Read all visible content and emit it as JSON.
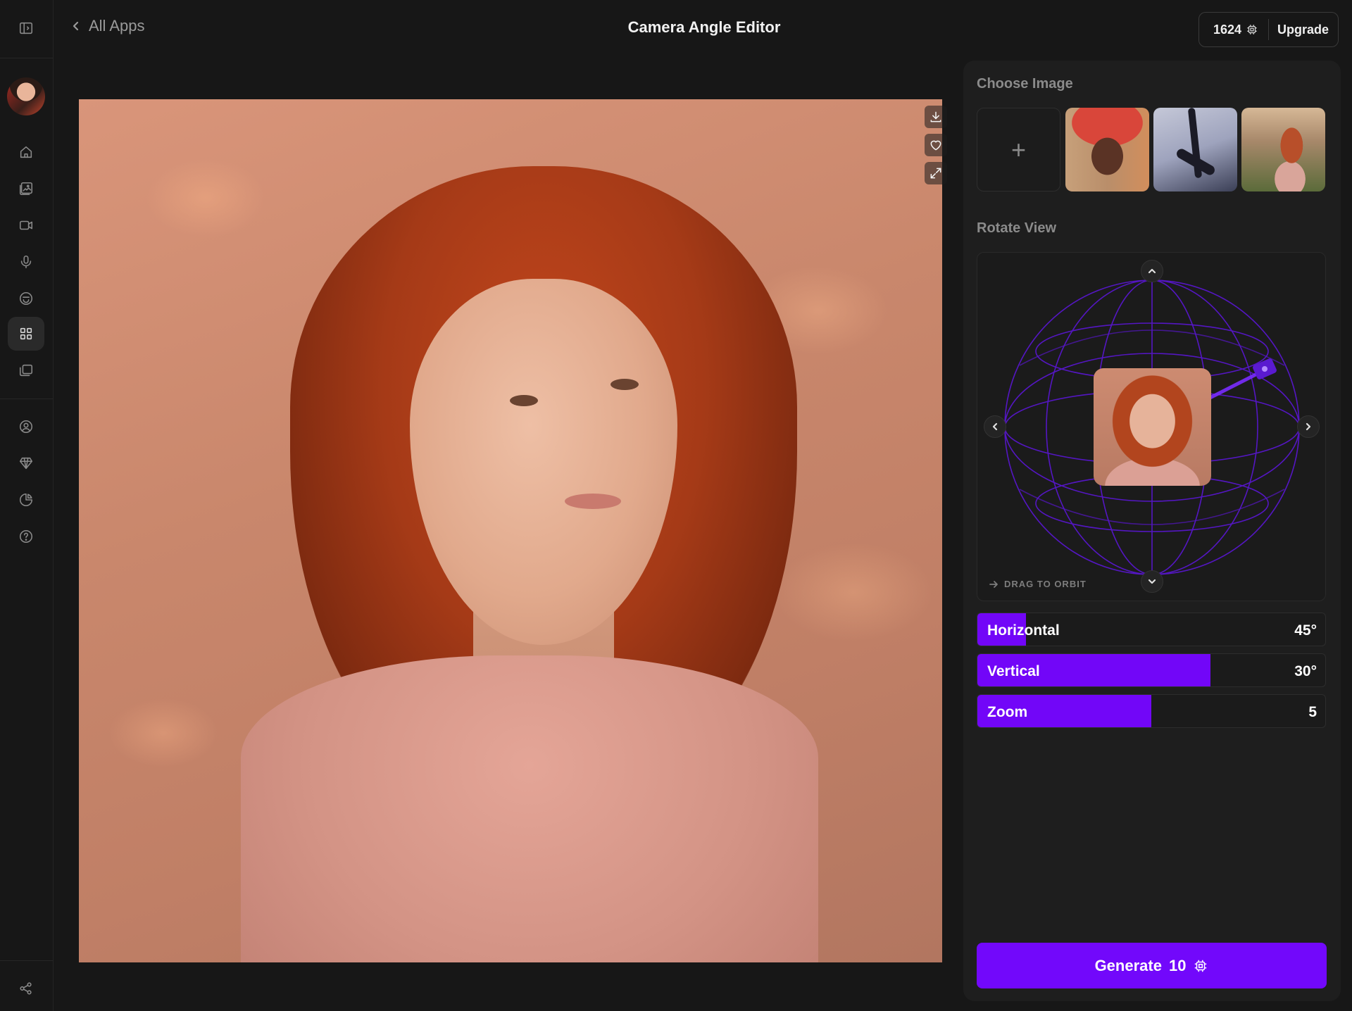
{
  "header": {
    "back_label": "All Apps",
    "title": "Camera Angle Editor",
    "credits": "1624",
    "upgrade_label": "Upgrade"
  },
  "sidebar": {
    "items": [
      "home-icon",
      "image-edit-icon",
      "video-icon",
      "microphone-icon",
      "smile-icon",
      "apps-grid-icon",
      "library-icon",
      "account-icon",
      "diamond-icon",
      "usage-chart-icon",
      "help-icon",
      "share-icon"
    ],
    "active": "apps-grid-icon"
  },
  "canvas": {
    "tools": [
      "download-icon",
      "heart-icon",
      "expand-icon"
    ]
  },
  "panel": {
    "choose_image_label": "Choose Image",
    "add_label": "+",
    "rotate_view_label": "Rotate View",
    "drag_hint": "DRAG TO ORBIT",
    "sliders": [
      {
        "label": "Horizontal",
        "value": "45°",
        "fill_fraction": 0.14
      },
      {
        "label": "Vertical",
        "value": "30°",
        "fill_fraction": 0.67
      },
      {
        "label": "Zoom",
        "value": "5",
        "fill_fraction": 0.5
      }
    ],
    "generate_label": "Generate",
    "generate_cost": "10"
  },
  "colors": {
    "accent": "#7206f8",
    "background": "#171717",
    "panel": "#1e1e1e",
    "globe_line": "#5b16d6"
  }
}
